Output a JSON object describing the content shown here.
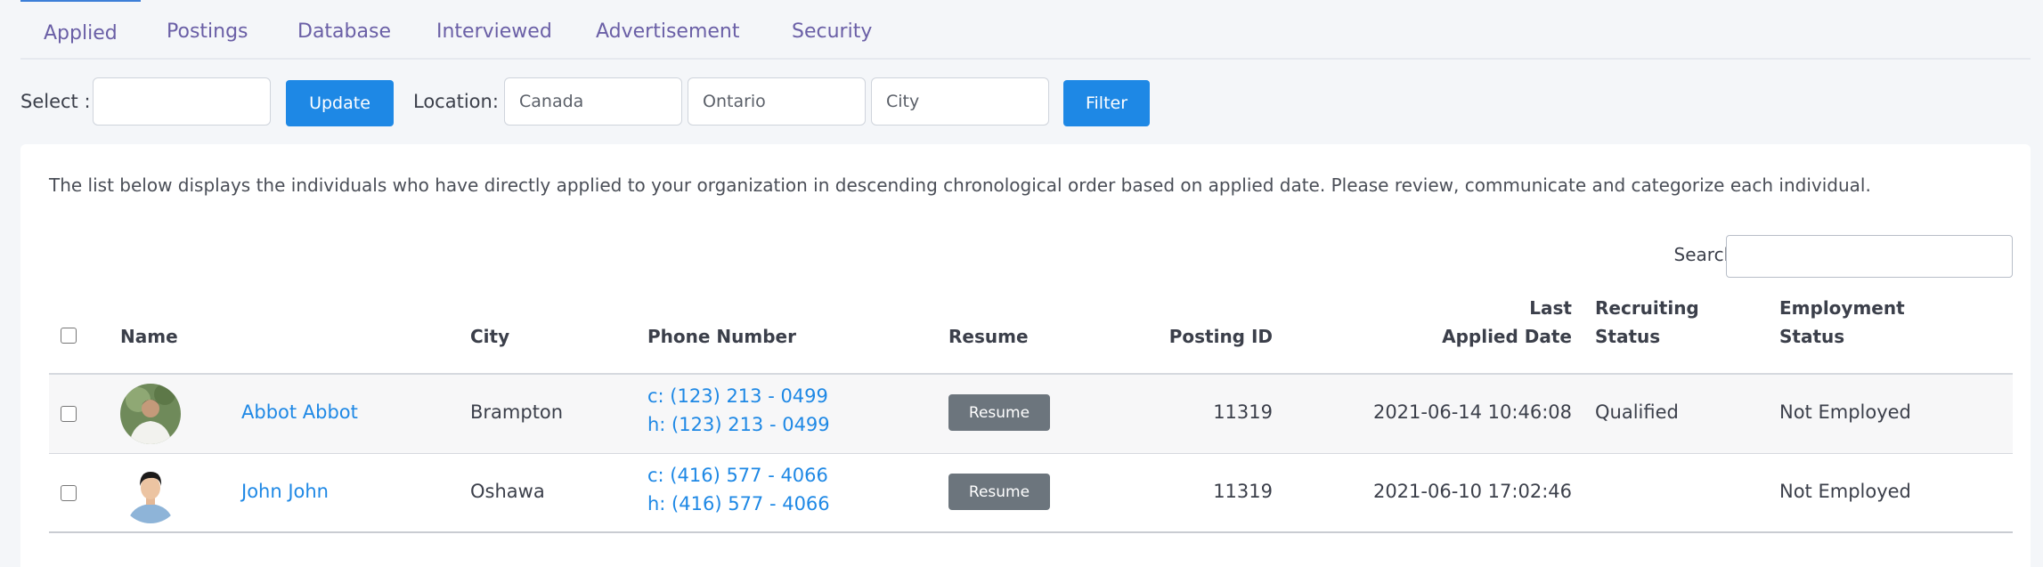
{
  "tabs": [
    {
      "label": "Applied",
      "active": true
    },
    {
      "label": "Postings"
    },
    {
      "label": "Database"
    },
    {
      "label": "Interviewed"
    },
    {
      "label": "Advertisement"
    },
    {
      "label": "Security"
    }
  ],
  "filter": {
    "select_label": "Select :",
    "select_value": "",
    "update_label": "Update",
    "location_label": "Location:",
    "country_placeholder": "Canada",
    "province_placeholder": "Ontario",
    "city_placeholder": "City",
    "filter_label": "Filter"
  },
  "card": {
    "description": "The list below displays the individuals who have directly applied to your organization in descending chronological order based on applied date. Please review, communicate and categorize each individual.",
    "search_label": "Search:",
    "search_value": ""
  },
  "table": {
    "headers": {
      "name": "Name",
      "city": "City",
      "phone": "Phone Number",
      "resume": "Resume",
      "posting_id": "Posting ID",
      "last_applied_line1": "Last",
      "last_applied_line2": "Applied Date",
      "recruiting_line1": "Recruiting",
      "recruiting_line2": "Status",
      "employment_line1": "Employment",
      "employment_line2": "Status"
    },
    "rows": [
      {
        "name": "Abbot Abbot",
        "city": "Brampton",
        "phone_cell": "c: (123) 213 - 0499",
        "phone_home": "h: (123) 213 - 0499",
        "resume_label": "Resume",
        "posting_id": "11319",
        "last_applied": "2021-06-14 10:46:08",
        "recruiting_status": "Qualified",
        "employment_status": "Not Employed"
      },
      {
        "name": "John John",
        "city": "Oshawa",
        "phone_cell": "c: (416) 577 - 4066",
        "phone_home": "h: (416) 577 - 4066",
        "resume_label": "Resume",
        "posting_id": "11319",
        "last_applied": "2021-06-10 17:02:46",
        "recruiting_status": "",
        "employment_status": "Not Employed"
      }
    ]
  },
  "colors": {
    "tab_text": "#6a5fa6",
    "primary_blue": "#1e88e5",
    "resume_gray": "#6c757d"
  }
}
